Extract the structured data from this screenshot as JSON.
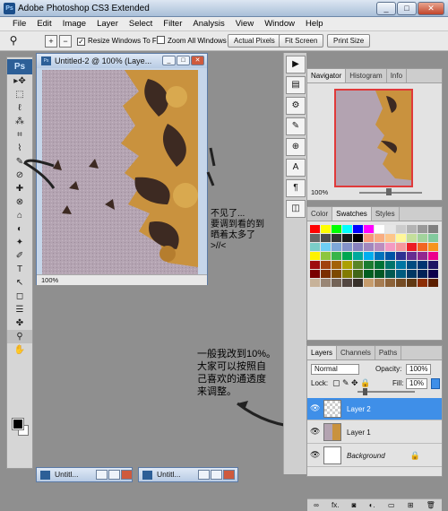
{
  "window": {
    "title": "Adobe Photoshop CS3 Extended",
    "btn_min": "_",
    "btn_max": "□",
    "btn_close": "✕"
  },
  "menubar": [
    "File",
    "Edit",
    "Image",
    "Layer",
    "Select",
    "Filter",
    "Analysis",
    "View",
    "Window",
    "Help"
  ],
  "options": {
    "resize_windows": "Resize Windows To Fit",
    "zoom_all": "Zoom All Windows",
    "actual_pixels": "Actual Pixels",
    "fit_screen": "Fit Screen",
    "print_size": "Print Size"
  },
  "toolbox": {
    "logo": "Ps",
    "tools": [
      "▸✥",
      "⬚",
      "ℓ",
      "⁂",
      "⌗",
      "⌇",
      "✎",
      "⊘",
      "✚",
      "⊗",
      "⌂",
      "◐",
      "✦",
      "✐",
      "T",
      "↖",
      "◻",
      "☰",
      "✤",
      "⚲",
      "✋"
    ]
  },
  "document": {
    "title": "Untitled-2 @ 100% (Laye...",
    "zoom": "100%"
  },
  "annotations": {
    "note1": "不见了...\n要调到看的到\n晒着太多了\n>//<",
    "note2": "一般我改到10%。\n大家可以按照自\n己喜欢的通透度\n来调整。"
  },
  "navigator": {
    "tabs": [
      "Navigator",
      "Histogram",
      "Info"
    ],
    "zoom": "100%"
  },
  "color_panel": {
    "tabs": [
      "Color",
      "Swatches",
      "Styles"
    ]
  },
  "layers_panel": {
    "tabs": [
      "Layers",
      "Channels",
      "Paths"
    ],
    "blend_mode": "Normal",
    "opacity_label": "Opacity:",
    "opacity": "100%",
    "lock_label": "Lock:",
    "fill_label": "Fill:",
    "fill": "10%",
    "layers": [
      {
        "name": "Layer 2",
        "selected": true
      },
      {
        "name": "Layer 1",
        "selected": false
      },
      {
        "name": "Background",
        "selected": false
      }
    ],
    "footer": [
      "∞",
      "fx.",
      "◙",
      "◐.",
      "▭",
      "⊞",
      "🗑"
    ]
  },
  "taskbar": [
    {
      "label": "Untitl..."
    },
    {
      "label": "Untitl..."
    }
  ],
  "icons": {
    "ps": "ps-logo-icon",
    "zoom": "zoom-tool-icon"
  }
}
